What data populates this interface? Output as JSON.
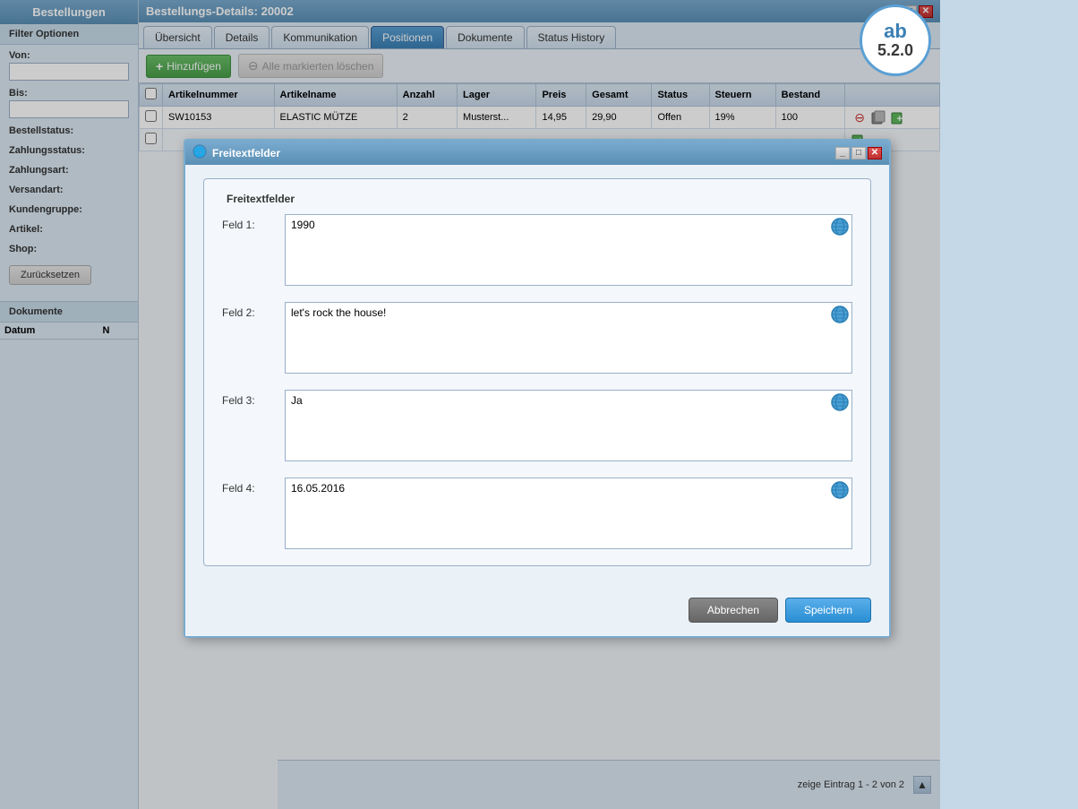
{
  "sidebar": {
    "title": "Bestellungen",
    "filter_title": "Filter Optionen",
    "labels": {
      "von": "Von:",
      "bis": "Bis:",
      "bestellstatus": "Bestellstatus:",
      "zahlungsstatus": "Zahlungsstatus:",
      "zahlungsart": "Zahlungsart:",
      "versandart": "Versandart:",
      "kundengruppe": "Kundengruppe:",
      "artikel": "Artikel:",
      "shop": "Shop:"
    },
    "reset_btn": "Zurücksetzen",
    "dokumente_title": "Dokumente",
    "dokumente_columns": [
      "Datum",
      "N"
    ]
  },
  "main_window": {
    "title": "Bestellungs-Details: 20002",
    "tabs": [
      {
        "label": "Übersicht",
        "active": false
      },
      {
        "label": "Details",
        "active": false
      },
      {
        "label": "Kommunikation",
        "active": false
      },
      {
        "label": "Positionen",
        "active": true
      },
      {
        "label": "Dokumente",
        "active": false
      },
      {
        "label": "Status History",
        "active": false
      }
    ],
    "toolbar": {
      "add_btn": "Hinzufügen",
      "delete_all_btn": "Alle markierten löschen"
    },
    "table": {
      "columns": [
        "Artikelnummer",
        "Artikelname",
        "Anzahl",
        "Lager",
        "Preis",
        "Gesamt",
        "Status",
        "Steuern",
        "Bestand"
      ],
      "rows": [
        {
          "artikelnummer": "SW10153",
          "artikelname": "ELASTIC MÜTZE",
          "anzahl": "2",
          "lager": "Musterst...",
          "preis": "14,95",
          "gesamt": "29,90",
          "status": "Offen",
          "steuern": "19%",
          "bestand": "100"
        }
      ]
    },
    "bottom_info": "zeige Eintrag 1 - 2 von 2"
  },
  "version": {
    "ab": "ab",
    "number": "5.2.0"
  },
  "dialog": {
    "title": "Freitextfelder",
    "group_label": "Freitextfelder",
    "fields": [
      {
        "label": "Feld 1:",
        "value": "1990",
        "name": "feld1"
      },
      {
        "label": "Feld 2:",
        "value": "let's rock the house!",
        "name": "feld2"
      },
      {
        "label": "Feld 3:",
        "value": "Ja",
        "name": "feld3"
      },
      {
        "label": "Feld 4:",
        "value": "16.05.2016",
        "name": "feld4"
      }
    ],
    "cancel_btn": "Abbrechen",
    "save_btn": "Speichern"
  }
}
